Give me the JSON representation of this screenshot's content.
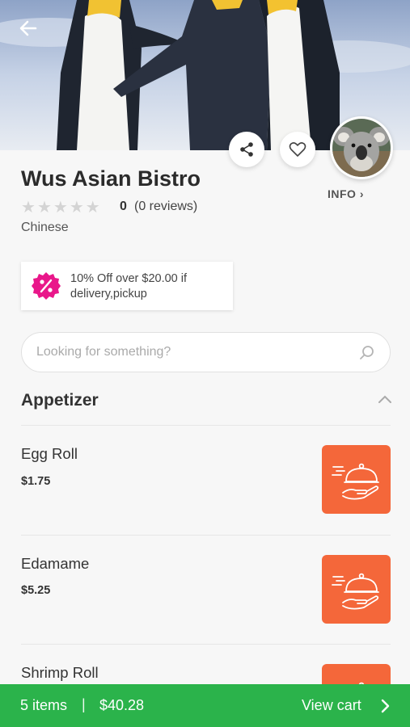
{
  "hero": {
    "image": "penguins-photo",
    "back_icon": "arrow-left-icon"
  },
  "actions": {
    "share_icon": "share-icon",
    "favorite_icon": "heart-icon",
    "avatar": "koala-avatar"
  },
  "restaurant": {
    "name": "Wus Asian Bistro",
    "rating": "0",
    "reviews": "(0 reviews)",
    "cuisine": "Chinese",
    "info_label": "INFO ›",
    "star_count": 5,
    "star_icon": "star-icon"
  },
  "promo": {
    "icon": "discount-badge-icon",
    "text": "10% Off over $20.00 if delivery,pickup",
    "badge_color": "#e9178a"
  },
  "search": {
    "placeholder": "Looking for something?",
    "value": "",
    "icon": "search-icon"
  },
  "menu": {
    "section_title": "Appetizer",
    "section_icon": "chevron-up-icon",
    "items": [
      {
        "name": "Egg Roll",
        "price": "$1.75",
        "thumb_icon": "food-service-icon"
      },
      {
        "name": "Edamame",
        "price": "$5.25",
        "thumb_icon": "food-service-icon"
      },
      {
        "name": "Shrimp Roll",
        "price": "",
        "thumb_icon": "food-service-icon"
      }
    ]
  },
  "cart": {
    "items_label": "5 items",
    "separator": "|",
    "total": "$40.28",
    "view_label": "View cart",
    "chevron_icon": "chevron-right-icon"
  },
  "colors": {
    "accent_green": "#2bb34b",
    "thumb_orange": "#f4673a",
    "promo_pink": "#e9178a"
  }
}
